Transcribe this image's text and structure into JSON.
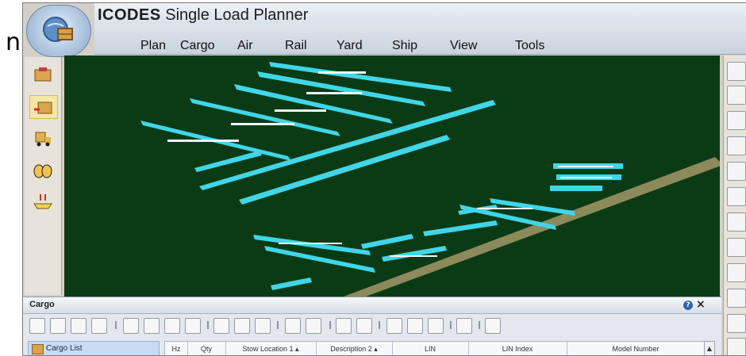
{
  "edge_text": "n",
  "app": {
    "title_bold": "ICODES",
    "title_rest": " Single Load Planner"
  },
  "menu": [
    {
      "label": "Plan"
    },
    {
      "label": "Cargo"
    },
    {
      "label": "Air"
    },
    {
      "label": "Rail"
    },
    {
      "label": "Yard"
    },
    {
      "label": "Ship"
    },
    {
      "label": "View"
    },
    {
      "label": "Tools"
    }
  ],
  "left_tools": [
    {
      "icon": "cargo-box-icon"
    },
    {
      "icon": "cargo-move-icon",
      "active": true
    },
    {
      "icon": "forklift-icon"
    },
    {
      "icon": "barrels-icon"
    },
    {
      "icon": "ship-load-icon"
    }
  ],
  "right_tools": [
    {
      "icon": "pan-icon"
    },
    {
      "icon": "fit-width-icon"
    },
    {
      "icon": "zoom-in-icon"
    },
    {
      "icon": "zoom-out-icon"
    },
    {
      "icon": "tool-5-icon"
    },
    {
      "icon": "tool-6-icon"
    },
    {
      "icon": "rotate-icon"
    },
    {
      "icon": "line-icon"
    },
    {
      "icon": "refresh-icon"
    },
    {
      "icon": "tree-icon"
    },
    {
      "icon": "stop-icon"
    },
    {
      "icon": "grid-icon"
    }
  ],
  "panel": {
    "title": "Cargo",
    "help_glyph": "?",
    "close_glyph": "×",
    "cargo_list_label": "Cargo List",
    "columns": [
      {
        "label": "Hz"
      },
      {
        "label": "Qty"
      },
      {
        "label": "Stow Location 1 ▴"
      },
      {
        "label": "Description 2 ▴"
      },
      {
        "label": "LIN"
      },
      {
        "label": "LIN Index"
      },
      {
        "label": "Model Number"
      }
    ],
    "scroll_glyph": "▲"
  },
  "colors": {
    "viewport_bg": "#0b3b14",
    "vehicle_cyan": "#40d6e8",
    "road": "#8c8a5b"
  }
}
